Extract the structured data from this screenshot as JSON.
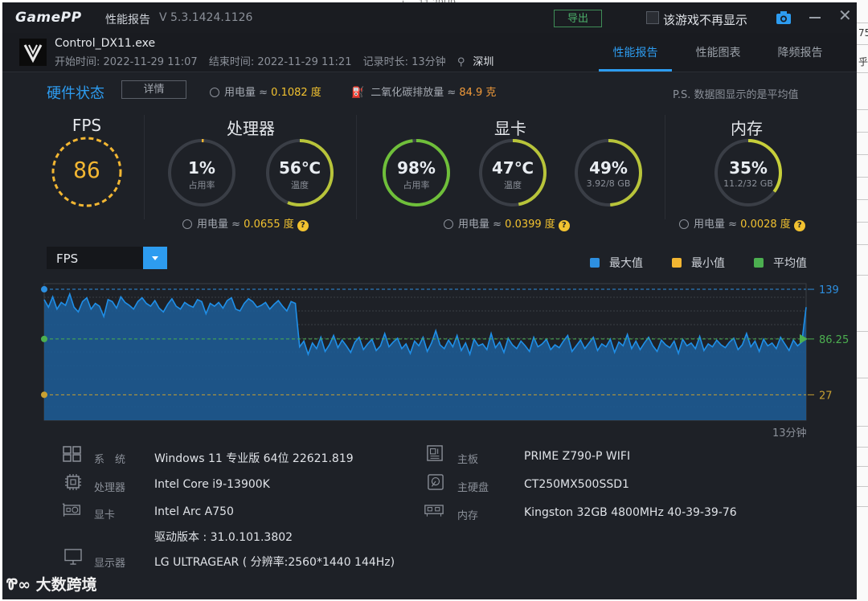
{
  "window": {
    "logo_text": "GamePP",
    "title": "性能报告",
    "version": "V 5.3.1424.1126",
    "export_label": "导出",
    "no_show_label": "该游戏不再显示"
  },
  "header": {
    "exe": "Control_DX11.exe",
    "start": "开始时间: 2022-11-29 11:07",
    "end": "结束时间: 2022-11-29 11:21",
    "duration": "记录时长: 13分钟",
    "city": "深圳",
    "tabs": [
      "性能报告",
      "性能图表",
      "降频报告"
    ],
    "active_tab": 0
  },
  "hardware": {
    "title": "硬件状态",
    "detail_label": "详情",
    "power_label": "用电量 ≈",
    "power_value": "0.1082 度",
    "co2_label": "二氧化碳排放量 ≈",
    "co2_value": "84.9 克",
    "note": "P.S. 数据图显示的是平均值"
  },
  "sections": {
    "fps": {
      "title": "FPS",
      "value": "86"
    },
    "cpu": {
      "title": "处理器",
      "usage": {
        "value": "1%",
        "label": "占用率",
        "fraction": 0.01
      },
      "temp": {
        "value": "56℃",
        "label": "温度",
        "fraction": 0.56
      },
      "power_label": "用电量 ≈",
      "power_value": "0.0655 度"
    },
    "gpu": {
      "title": "显卡",
      "usage": {
        "value": "98%",
        "label": "占用率",
        "fraction": 0.98
      },
      "temp": {
        "value": "47℃",
        "label": "温度",
        "fraction": 0.47
      },
      "mem": {
        "value": "49%",
        "label": "3.92/8 GB",
        "fraction": 0.49
      },
      "power_label": "用电量 ≈",
      "power_value": "0.0399 度"
    },
    "memory": {
      "title": "内存",
      "usage": {
        "value": "35%",
        "label": "11.2/32 GB",
        "fraction": 0.35
      },
      "power_label": "用电量 ≈",
      "power_value": "0.0028 度"
    }
  },
  "chart_controls": {
    "metric": "FPS",
    "legend": [
      {
        "name": "最大值",
        "color": "#2d8fe0"
      },
      {
        "name": "最小值",
        "color": "#f2b632"
      },
      {
        "name": "平均值",
        "color": "#4caf50"
      }
    ]
  },
  "chart_data": {
    "type": "area",
    "series_name": "FPS",
    "max": 139,
    "avg": 86.25,
    "min": 27,
    "x_end_label": "13分钟",
    "ylim": [
      0,
      145
    ],
    "values": [
      128,
      120,
      131,
      118,
      125,
      122,
      134,
      120,
      115,
      126,
      130,
      118,
      124,
      121,
      110,
      128,
      126,
      119,
      131,
      125,
      122,
      118,
      126,
      130,
      124,
      121,
      127,
      119,
      115,
      123,
      129,
      121,
      118,
      125,
      122,
      120,
      128,
      126,
      113,
      124,
      121,
      125,
      119,
      127,
      130,
      118,
      116,
      124,
      129,
      126,
      120,
      122,
      125,
      118,
      123,
      127,
      121,
      116,
      126,
      124,
      78,
      84,
      70,
      82,
      76,
      88,
      73,
      80,
      90,
      77,
      85,
      79,
      72,
      83,
      88,
      75,
      81,
      86,
      74,
      79,
      92,
      78,
      83,
      87,
      76,
      81,
      71,
      84,
      79,
      88,
      73,
      82,
      95,
      80,
      76,
      85,
      78,
      90,
      74,
      82,
      70,
      86,
      79,
      81,
      75,
      92,
      77,
      83,
      72,
      87,
      80,
      76,
      84,
      79,
      73,
      88,
      78,
      81,
      86,
      75,
      80,
      77,
      84,
      90,
      73,
      79,
      85,
      76,
      82,
      88,
      74,
      81,
      78,
      86,
      72,
      83,
      79,
      91,
      76,
      84,
      75,
      82,
      88,
      79,
      73,
      85,
      80,
      77,
      84,
      71,
      86,
      79,
      82,
      76,
      89,
      74,
      81,
      78,
      85,
      80,
      77,
      83,
      87,
      75,
      80,
      92,
      78,
      84,
      73,
      86,
      79,
      82,
      76,
      88,
      81,
      74,
      85,
      79,
      83,
      120
    ]
  },
  "sysinfo": {
    "left": [
      {
        "label": "系　统",
        "value": "Windows 11 专业版 64位 22621.819"
      },
      {
        "label": "处理器",
        "value": "Intel Core i9-13900K"
      },
      {
        "label": "显卡",
        "value": "Intel Arc A750"
      },
      {
        "label": "",
        "value": "驱动版本 : 31.0.101.3802"
      },
      {
        "label": "显示器",
        "value": "LG ULTRAGEAR ( 分辨率:2560*1440 144Hz)"
      }
    ],
    "right": [
      {
        "label": "主板",
        "value": "PRIME Z790-P WIFI"
      },
      {
        "label": "主硬盘",
        "value": "CT250MX500SSD1"
      },
      {
        "label": "内存",
        "value": "Kingston 32GB 4800MHz 40-39-39-76"
      }
    ]
  },
  "watermark": "大数跨境"
}
